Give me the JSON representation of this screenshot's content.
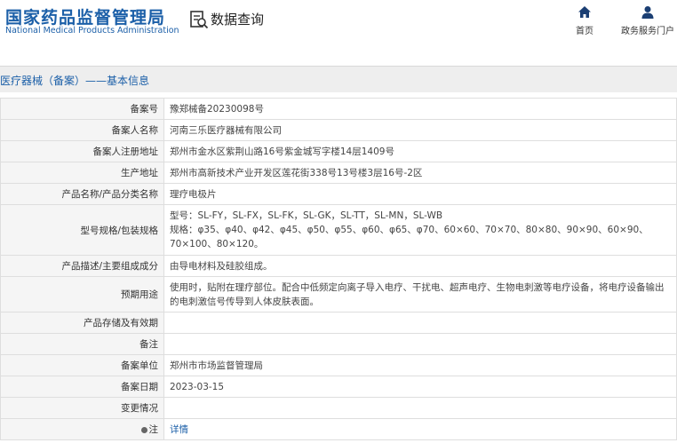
{
  "header": {
    "logo_cn": "国家药品监督管理局",
    "logo_en": "National Medical Products Administration",
    "query_title": "数据查询",
    "nav": [
      {
        "label": "首页",
        "icon": "home-icon"
      },
      {
        "label": "政务服务门户",
        "icon": "user-icon"
      }
    ]
  },
  "section_title": "医疗器械（备案）——基本信息",
  "colors": {
    "brand": "#1b5fa8",
    "label_bg": "#f5f5f5",
    "border": "#dedede"
  },
  "rows": [
    {
      "label": "备案号",
      "value": "豫郑械备20230098号"
    },
    {
      "label": "备案人名称",
      "value": "河南三乐医疗器械有限公司"
    },
    {
      "label": "备案人注册地址",
      "value": "郑州市金水区紫荆山路16号紫金城写字楼14层1409号"
    },
    {
      "label": "生产地址",
      "value": "郑州市高新技术产业开发区莲花街338号13号楼3层16号-2区"
    },
    {
      "label": "产品名称/产品分类名称",
      "value": "理疗电极片"
    },
    {
      "label": "型号规格/包装规格",
      "value_line1": "型号：SL-FY，SL-FX，SL-FK，SL-GK，SL-TT，SL-MN，SL-WB",
      "value_line2": "规格：φ35、φ40、φ42、φ45、φ50、φ55、φ60、φ65、φ70、60×60、70×70、80×80、90×90、60×90、70×100、80×120。"
    },
    {
      "label": "产品描述/主要组成成分",
      "value": "由导电材料及硅胶组成。"
    },
    {
      "label": "预期用途",
      "value": "使用时，贴附在理疗部位。配合中低频定向离子导入电疗、干扰电、超声电疗、生物电刺激等电疗设备，将电疗设备输出的电刺激信号传导到人体皮肤表面。"
    },
    {
      "label": "产品存储及有效期",
      "value": ""
    },
    {
      "label": "备注",
      "value": ""
    },
    {
      "label": "备案单位",
      "value": "郑州市市场监督管理局"
    },
    {
      "label": "备案日期",
      "value": "2023-03-15"
    },
    {
      "label": "变更情况",
      "value": ""
    },
    {
      "label": "注",
      "value": "详情",
      "icon": "info-icon"
    }
  ]
}
